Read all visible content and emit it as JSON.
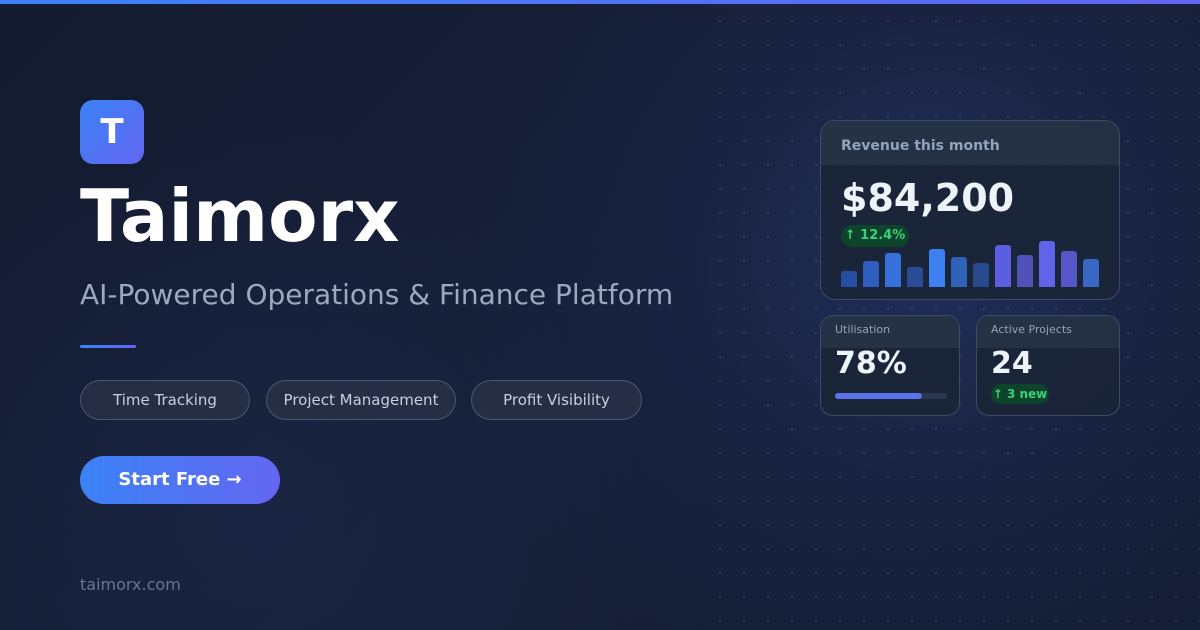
{
  "brand": {
    "logo_letter": "T",
    "name": "Taimorx",
    "tagline": "AI-Powered Operations & Finance Platform",
    "domain": "taimorx.com"
  },
  "features": [
    "Time Tracking",
    "Project Management",
    "Profit Visibility"
  ],
  "cta": {
    "label": "Start Free →"
  },
  "dashboard": {
    "revenue_card": {
      "title": "Revenue this month",
      "value": "$84,200",
      "change": "↑ 12.4%"
    },
    "utilisation_card": {
      "title": "Utilisation",
      "value": "78%",
      "progress_fraction": 0.78
    },
    "projects_card": {
      "title": "Active Projects",
      "value": "24",
      "change": "↑ 3 new"
    }
  },
  "chart_data": {
    "type": "bar",
    "values": [
      16,
      26,
      34,
      20,
      38,
      30,
      24,
      42,
      32,
      46,
      36,
      28
    ],
    "colors": [
      "#284ea3",
      "#2f5fbe",
      "#3570db",
      "#294c97",
      "#3c80f2",
      "#2e63b7",
      "#284a8c",
      "#5b5ee0",
      "#4f52b7",
      "#6064e8",
      "#5556c8",
      "#3967c4"
    ]
  },
  "colors": {
    "accent_blue": "#3b82f6",
    "accent_indigo": "#6366f1",
    "success": "#39d17a"
  },
  "icons": {
    "logo": "t-logo-icon",
    "revenue_trend": "up-arrow-icon",
    "projects_trend": "up-arrow-icon"
  }
}
